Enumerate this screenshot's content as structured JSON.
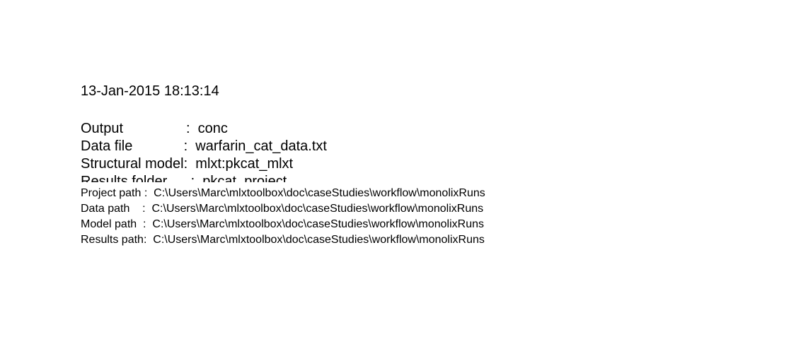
{
  "timestamp": "13-Jan-2015 18:13:14",
  "summary": [
    {
      "label": "Output                ",
      "sep": ":  ",
      "value": "conc"
    },
    {
      "label": "Data file             ",
      "sep": ":  ",
      "value": "warfarin_cat_data.txt"
    },
    {
      "label": "Structural model",
      "sep": ":  ",
      "value": "mlxt:pkcat_mlxt"
    },
    {
      "label": "Results folder      ",
      "sep": ":  ",
      "value": "pkcat_project"
    }
  ],
  "paths": [
    {
      "label": "Project path :  ",
      "value": "C:\\Users\\Marc\\mlxtoolbox\\doc\\caseStudies\\workflow\\monolixRuns"
    },
    {
      "label": "Data path    :  ",
      "value": "C:\\Users\\Marc\\mlxtoolbox\\doc\\caseStudies\\workflow\\monolixRuns"
    },
    {
      "label": "Model path  :  ",
      "value": "C:\\Users\\Marc\\mlxtoolbox\\doc\\caseStudies\\workflow\\monolixRuns"
    },
    {
      "label": "Results path:  ",
      "value": "C:\\Users\\Marc\\mlxtoolbox\\doc\\caseStudies\\workflow\\monolixRuns"
    }
  ]
}
